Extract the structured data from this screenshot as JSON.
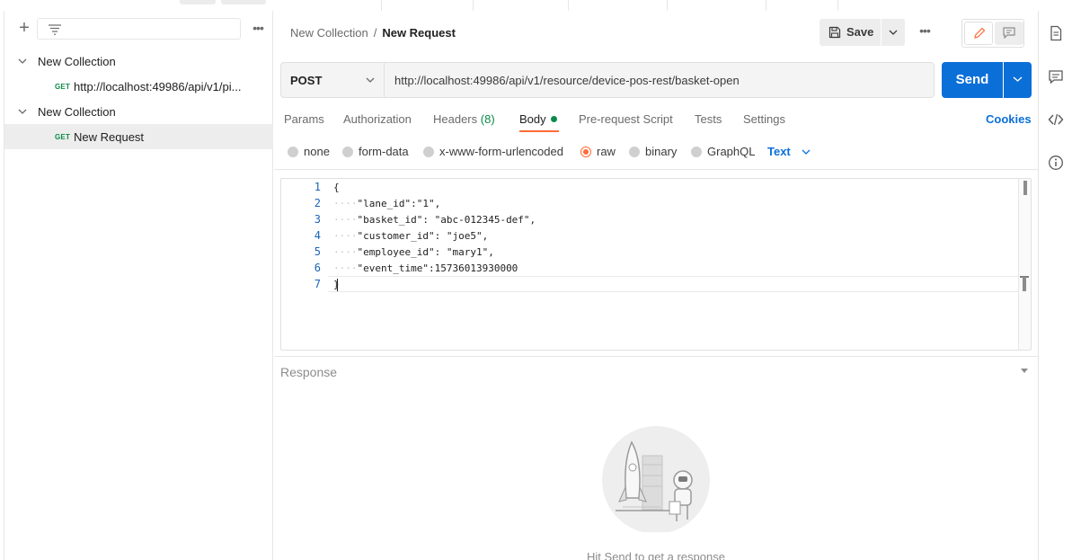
{
  "sidebar": {
    "filter_placeholder": "",
    "collections": [
      {
        "name": "New Collection",
        "requests": [
          {
            "method": "GET",
            "name": "http://localhost:49986/api/v1/pi..."
          }
        ]
      },
      {
        "name": "New Collection",
        "requests": [
          {
            "method": "GET",
            "name": "New Request"
          }
        ]
      }
    ]
  },
  "header": {
    "breadcrumb_parent": "New Collection",
    "breadcrumb_separator": "/",
    "breadcrumb_current": "New Request",
    "save_label": "Save"
  },
  "request": {
    "method": "POST",
    "url": "http://localhost:49986/api/v1/resource/device-pos-rest/basket-open",
    "send_label": "Send"
  },
  "tabs": {
    "params": "Params",
    "authorization": "Authorization",
    "headers": "Headers",
    "headers_count": "(8)",
    "body": "Body",
    "prerequest": "Pre-request Script",
    "tests": "Tests",
    "settings": "Settings",
    "cookies": "Cookies",
    "active": "Body"
  },
  "body_options": {
    "none": "none",
    "form_data": "form-data",
    "urlencoded": "x-www-form-urlencoded",
    "raw": "raw",
    "binary": "binary",
    "graphql": "GraphQL",
    "selected": "raw",
    "format": "Text"
  },
  "editor": {
    "lines": [
      {
        "n": "1",
        "indent": "",
        "text": "{"
      },
      {
        "n": "2",
        "indent": "····",
        "text": "\"lane_id\":\"1\","
      },
      {
        "n": "3",
        "indent": "····",
        "text": "\"basket_id\": \"abc-012345-def\","
      },
      {
        "n": "4",
        "indent": "····",
        "text": "\"customer_id\": \"joe5\","
      },
      {
        "n": "5",
        "indent": "····",
        "text": "\"employee_id\": \"mary1\","
      },
      {
        "n": "6",
        "indent": "····",
        "text": "\"event_time\":15736013930000"
      },
      {
        "n": "7",
        "indent": "",
        "text": "}"
      }
    ]
  },
  "response": {
    "label": "Response",
    "hint": "Hit Send to get a response"
  },
  "colors": {
    "accent": "#ff6c37",
    "primary": "#0b6fd8",
    "success": "#0c8a4a"
  },
  "icons": {
    "rail": [
      "document-icon",
      "comment-icon",
      "code-icon",
      "info-icon"
    ]
  }
}
